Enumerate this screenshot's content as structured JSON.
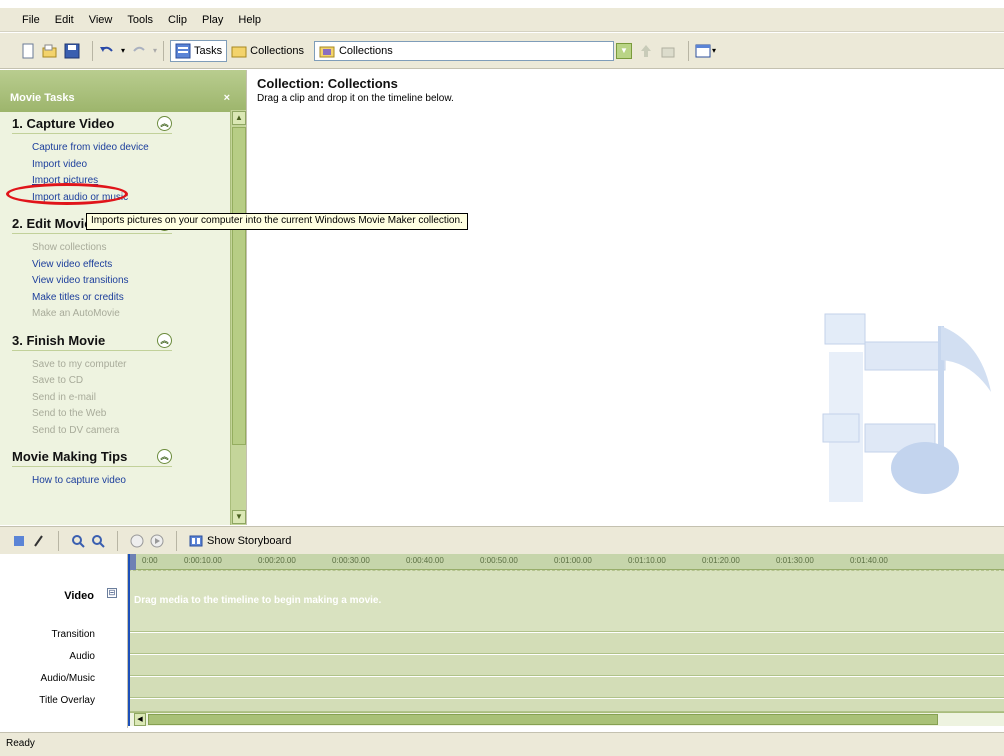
{
  "menu": [
    "File",
    "Edit",
    "View",
    "Tools",
    "Clip",
    "Play",
    "Help"
  ],
  "toolbar": {
    "tasks_label": "Tasks",
    "collections_label": "Collections",
    "collection_combo_value": "Collections"
  },
  "task_pane": {
    "title": "Movie Tasks",
    "close": "×",
    "sections": [
      {
        "heading": "1. Capture Video",
        "items": [
          {
            "label": "Capture from video device",
            "enabled": true
          },
          {
            "label": "Import video",
            "enabled": true
          },
          {
            "label": "Import pictures",
            "enabled": true
          },
          {
            "label": "Import audio or music",
            "enabled": true
          }
        ]
      },
      {
        "heading": "2. Edit Movie",
        "items": [
          {
            "label": "Show collections",
            "enabled": false
          },
          {
            "label": "View video effects",
            "enabled": true
          },
          {
            "label": "View video transitions",
            "enabled": true
          },
          {
            "label": "Make titles or credits",
            "enabled": true
          },
          {
            "label": "Make an AutoMovie",
            "enabled": false
          }
        ]
      },
      {
        "heading": "3. Finish Movie",
        "items": [
          {
            "label": "Save to my computer",
            "enabled": false
          },
          {
            "label": "Save to CD",
            "enabled": false
          },
          {
            "label": "Send in e-mail",
            "enabled": false
          },
          {
            "label": "Send to the Web",
            "enabled": false
          },
          {
            "label": "Send to DV camera",
            "enabled": false
          }
        ]
      },
      {
        "heading": "Movie Making Tips",
        "items": [
          {
            "label": "How to capture video",
            "enabled": true
          }
        ]
      }
    ]
  },
  "tooltip": "Imports pictures on your computer into the current Windows Movie Maker collection.",
  "content": {
    "title": "Collection: Collections",
    "subtitle": "Drag a clip and drop it on the timeline below."
  },
  "timeline": {
    "show_storyboard_label": "Show Storyboard",
    "ruler_ticks": [
      "0:00",
      "0:00:10.00",
      "0:00:20.00",
      "0:00:30.00",
      "0:00:40.00",
      "0:00:50.00",
      "0:01:00.00",
      "0:01:10.00",
      "0:01:20.00",
      "0:01:30.00",
      "0:01:40.00"
    ],
    "tracks": {
      "video": "Video",
      "transition": "Transition",
      "audio": "Audio",
      "audio_music": "Audio/Music",
      "title_overlay": "Title Overlay"
    },
    "drag_hint": "Drag media to the timeline to begin making a movie."
  },
  "status": "Ready",
  "colors": {
    "task_link": "#1c3e9c",
    "disabled_link": "#a8ab9a",
    "highlight_ring": "#e0141a"
  }
}
